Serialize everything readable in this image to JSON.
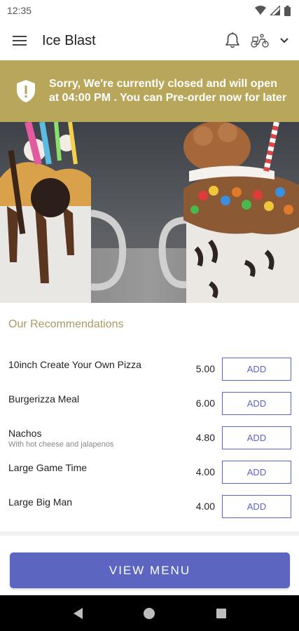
{
  "status_bar": {
    "time": "12:35",
    "icons": [
      "wifi-icon",
      "signal-icon",
      "battery-icon"
    ]
  },
  "app_bar": {
    "title": "Ice Blast",
    "icons": [
      "menu-icon",
      "bell-icon",
      "delivery-scooter-icon",
      "chevron-down-icon"
    ]
  },
  "closed_banner": {
    "icon": "shield-alert-icon",
    "message": "Sorry, We're currently closed and will open at 04:00 PM . You can Pre-order now for later",
    "color": "#b8a65a"
  },
  "hero": {
    "alt": "freakshake-milkshakes-photo"
  },
  "recommendations": {
    "title": "Our Recommendations",
    "items": [
      {
        "name": "10inch Create Your Own Pizza",
        "description": "",
        "price": "5.00",
        "button": "ADD"
      },
      {
        "name": "Burgerizza Meal",
        "description": "",
        "price": "6.00",
        "button": "ADD"
      },
      {
        "name": "Nachos",
        "description": "With hot cheese and jalapenos",
        "price": "4.80",
        "button": "ADD"
      },
      {
        "name": "Large Game Time",
        "description": "",
        "price": "4.00",
        "button": "ADD"
      },
      {
        "name": "Large Big Man",
        "description": "",
        "price": "4.00",
        "button": "ADD"
      }
    ]
  },
  "view_menu": {
    "label": "VIEW MENU",
    "color": "#5c65c0"
  },
  "nav_bar": {
    "icons": [
      "back-icon",
      "home-icon",
      "recents-icon"
    ]
  }
}
